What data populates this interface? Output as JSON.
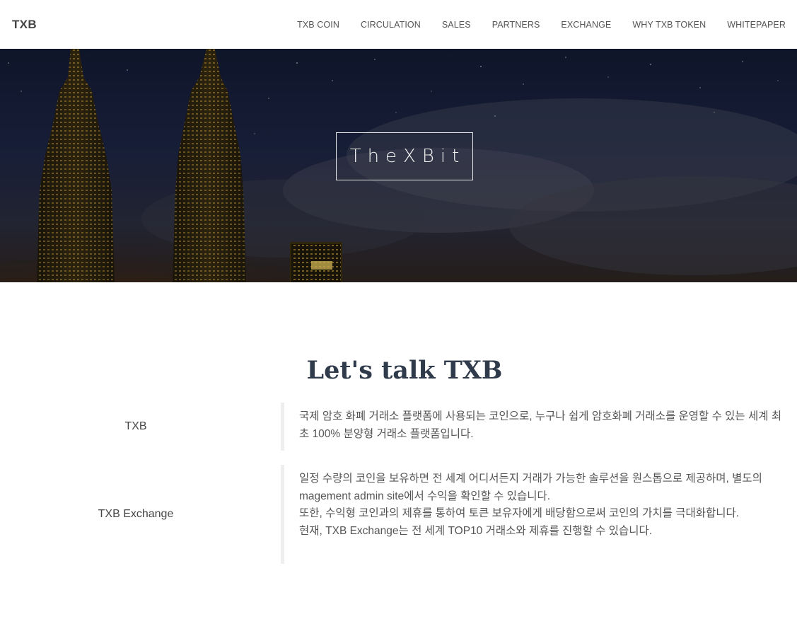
{
  "navbar": {
    "brand": "TXB",
    "links": [
      "TXB COIN",
      "CIRCULATION",
      "SALES",
      "PARTNERS",
      "EXCHANGE",
      "WHY TXB TOKEN",
      "WHITEPAPER"
    ]
  },
  "hero": {
    "title": "TheXBit"
  },
  "about": {
    "title": "Let's talk TXB",
    "rows": [
      {
        "label": "TXB",
        "lines": [
          "국제 암호 화폐 거래소 플랫폼에 사용되는 코인으로, 누구나 쉽게 암호화폐 거래소를 운영할 수 있는 세계 최초 100% 분양형 거래소 플랫폼입니다."
        ]
      },
      {
        "label": "TXB Exchange",
        "lines": [
          "일정 수량의 코인을 보유하면 전 세계 어디서든지 거래가 가능한 솔루션을 원스톱으로 제공하며, 별도의 magement admin site에서 수익을 확인할 수 있습니다.",
          "또한, 수익형 코인과의 제휴를 통하여 토큰 보유자에게 배당함으로써 코인의 가치를 극대화합니다.",
          "현재, TXB Exchange는 전 세계 TOP10 거래소와 제휴를 진행할 수 있습니다."
        ]
      }
    ]
  }
}
